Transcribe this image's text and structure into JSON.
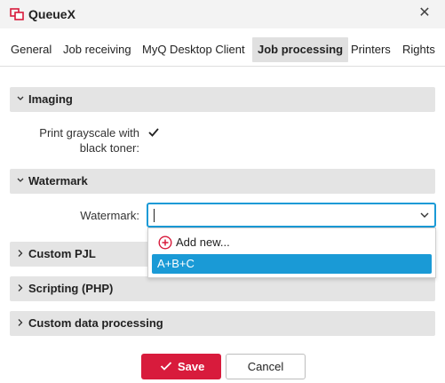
{
  "window": {
    "title": "QueueX",
    "app_icon": "queue-icon",
    "close_icon": "close-icon",
    "brand_color": "#d81b3c"
  },
  "tabs": [
    {
      "label": "General"
    },
    {
      "label": "Job receiving"
    },
    {
      "label": "MyQ Desktop Client"
    },
    {
      "label": "Job processing",
      "active": true
    },
    {
      "label": "Printers"
    },
    {
      "label": "Rights"
    }
  ],
  "sections": {
    "imaging": {
      "label": "Imaging",
      "expanded": true,
      "grayscale_label_line1": "Print grayscale with",
      "grayscale_label_line2": "black toner:",
      "grayscale_checked": true
    },
    "watermark": {
      "label": "Watermark",
      "expanded": true,
      "field_label": "Watermark:",
      "value": "",
      "options": {
        "add_new": "Add new...",
        "items": [
          "A+B+C"
        ],
        "highlighted": "A+B+C"
      },
      "accent_color": "#1a9ad6"
    },
    "custom_pjl": {
      "label": "Custom PJL",
      "expanded": false
    },
    "scripting": {
      "label": "Scripting (PHP)",
      "expanded": false
    },
    "custom_data": {
      "label": "Custom data processing",
      "expanded": false
    }
  },
  "buttons": {
    "save": "Save",
    "cancel": "Cancel"
  }
}
